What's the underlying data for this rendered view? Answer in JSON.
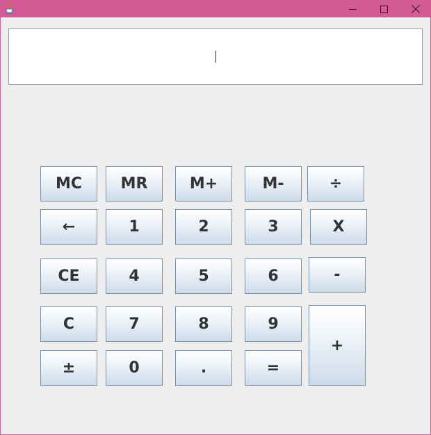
{
  "window": {
    "icon": "java-cup-icon",
    "controls": [
      "minimize-icon",
      "maximize-icon",
      "close-icon"
    ]
  },
  "display": {
    "value": ""
  },
  "keys": {
    "mc": "MC",
    "mr": "MR",
    "m_plus": "M+",
    "m_minus": "M-",
    "divide": "÷",
    "backspace": "←",
    "one": "1",
    "two": "2",
    "three": "3",
    "multiply": "X",
    "ce": "CE",
    "four": "4",
    "five": "5",
    "six": "6",
    "minus": "-",
    "c": "C",
    "seven": "7",
    "eight": "8",
    "nine": "9",
    "plus": "+",
    "plus_minus": "±",
    "zero": "0",
    "dot": ".",
    "equals": "="
  }
}
